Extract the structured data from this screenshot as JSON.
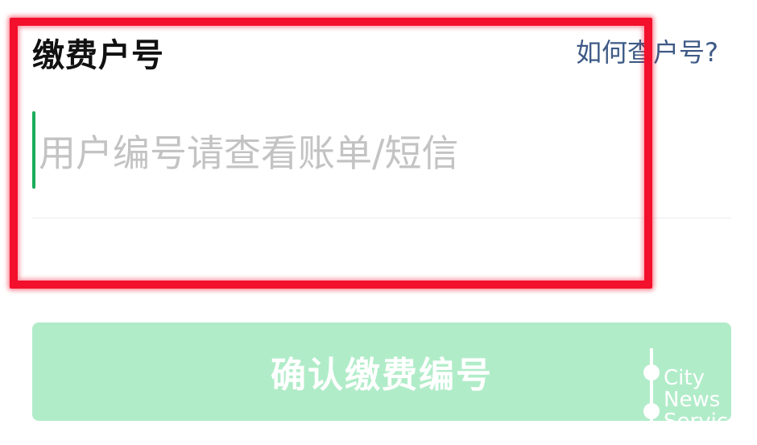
{
  "header": {
    "title": "缴费户号",
    "help_link": "如何查户号?"
  },
  "account_input": {
    "value": "",
    "placeholder": "用户编号请查看账单/短信"
  },
  "confirm_button": {
    "label": "确认缴费编号"
  },
  "watermark": {
    "lines": [
      "City",
      "News",
      "Servic"
    ]
  },
  "colors": {
    "accent_green": "#1aad5b",
    "button_disabled": "#b1ecc9",
    "link": "#3e5a86",
    "highlight": "#f2102c"
  }
}
